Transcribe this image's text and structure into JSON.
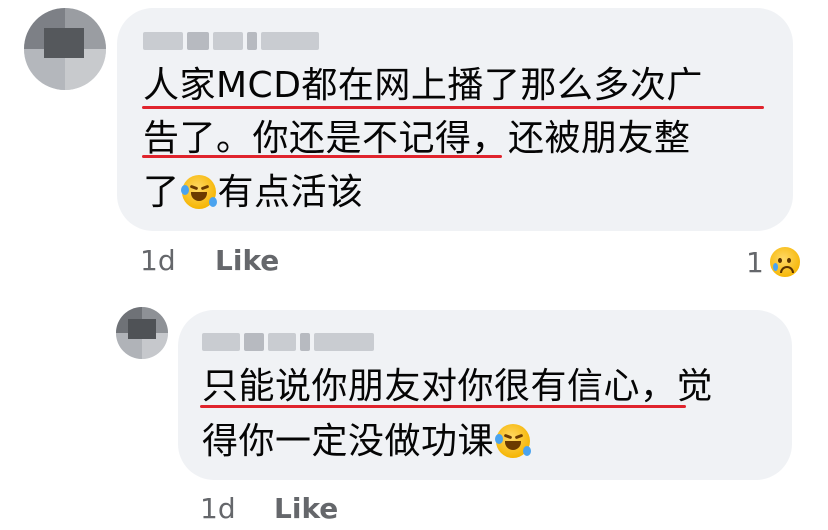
{
  "comment1": {
    "author_name": "Vivian Bee",
    "lines": [
      {
        "text": "人家MCD都在网上播了那么多次广",
        "emoji": null,
        "after": ""
      },
      {
        "text": "告了。你还是不记得，还被朋友整",
        "emoji": null,
        "after": ""
      },
      {
        "text": "了",
        "emoji": "rolling-on-floor-laughing",
        "after": "有点活该"
      }
    ],
    "time": "1d",
    "like_label": "Like",
    "reaction_count": "1",
    "reaction_icon": "sad-tear-icon"
  },
  "comment2": {
    "author_name": "Vivian Bee",
    "lines": [
      {
        "text": "只能说你朋友对你很有信心，觉",
        "emoji": null,
        "after": ""
      },
      {
        "text": "得你一定没做功课",
        "emoji": "rolling-on-floor-laughing",
        "after": ""
      }
    ],
    "time": "1d",
    "like_label": "Like"
  },
  "colors": {
    "bubble": "#f0f2f5",
    "text": "#050505",
    "meta": "#65676b",
    "underline": "#e0242d"
  }
}
